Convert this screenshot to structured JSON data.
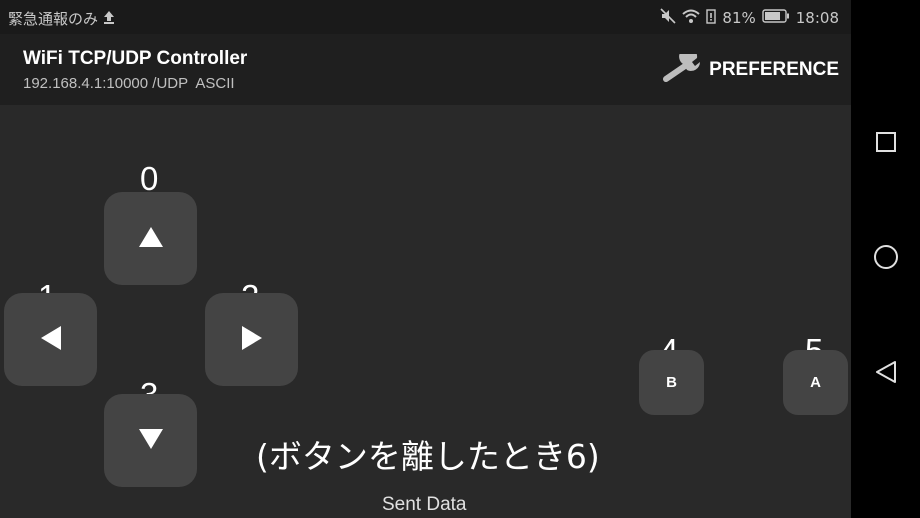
{
  "status_bar": {
    "left_text": "緊急通報のみ",
    "battery_percent": "81%",
    "time": "18:08"
  },
  "toolbar": {
    "title": "WiFi TCP/UDP Controller",
    "subtitle": "192.168.4.1:10000 /UDP  ASCII",
    "preference_label": "PREFERENCE"
  },
  "controller": {
    "dpad": {
      "up_number": "0",
      "left_number": "1",
      "right_number": "2",
      "down_number": "3"
    },
    "buttons": {
      "b_number": "4",
      "b_label": "B",
      "a_number": "5",
      "a_label": "A"
    },
    "release_note": "(ボタンを離したとき6)",
    "sent_data_label": "Sent Data"
  },
  "colors": {
    "app_background": "#292929",
    "toolbar_background": "#1f1f1f",
    "button_background": "#444444"
  }
}
